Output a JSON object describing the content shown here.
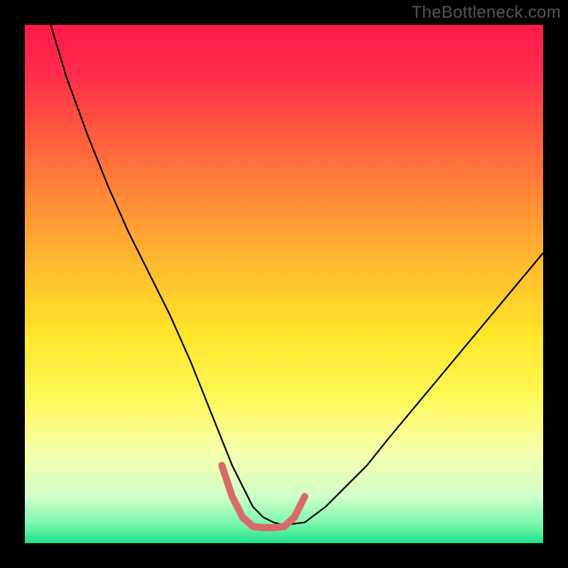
{
  "watermark": "TheBottleneck.com",
  "chart_data": {
    "type": "line",
    "title": "",
    "xlabel": "",
    "ylabel": "",
    "xlim": [
      0,
      100
    ],
    "ylim": [
      0,
      100
    ],
    "axes_visible": false,
    "grid": false,
    "background_gradient": {
      "stops": [
        {
          "offset": 0.0,
          "color": "#ff1a4b"
        },
        {
          "offset": 0.1,
          "color": "#ff2e4a"
        },
        {
          "offset": 0.25,
          "color": "#ff6a3c"
        },
        {
          "offset": 0.45,
          "color": "#ffb62f"
        },
        {
          "offset": 0.6,
          "color": "#ffe62a"
        },
        {
          "offset": 0.72,
          "color": "#fff85a"
        },
        {
          "offset": 0.83,
          "color": "#f5ffb0"
        },
        {
          "offset": 0.91,
          "color": "#d0ffc8"
        },
        {
          "offset": 0.96,
          "color": "#7ff7b0"
        },
        {
          "offset": 1.0,
          "color": "#20e28d"
        }
      ]
    },
    "series": [
      {
        "name": "bottleneck-curve",
        "stroke": "#000000",
        "stroke_width": 2.2,
        "x": [
          5,
          8,
          12,
          16,
          20,
          24,
          28,
          32,
          34,
          36,
          38,
          40,
          42,
          44,
          46,
          48,
          50,
          54,
          58,
          62,
          66,
          70,
          75,
          80,
          85,
          90,
          95,
          100
        ],
        "y": [
          100,
          90,
          79,
          69,
          60,
          52,
          44,
          35,
          30,
          25,
          20,
          15,
          11,
          7,
          5,
          4,
          3.5,
          4,
          7,
          11,
          15,
          20,
          26,
          32,
          38,
          44,
          50,
          56
        ]
      },
      {
        "name": "optimal-band",
        "stroke": "#d86a6a",
        "stroke_width": 10,
        "linecap": "round",
        "x": [
          38,
          40,
          42,
          44,
          46,
          48,
          50,
          52,
          54
        ],
        "y": [
          15,
          9,
          5,
          3.2,
          3,
          3,
          3.2,
          5,
          9
        ]
      }
    ]
  }
}
